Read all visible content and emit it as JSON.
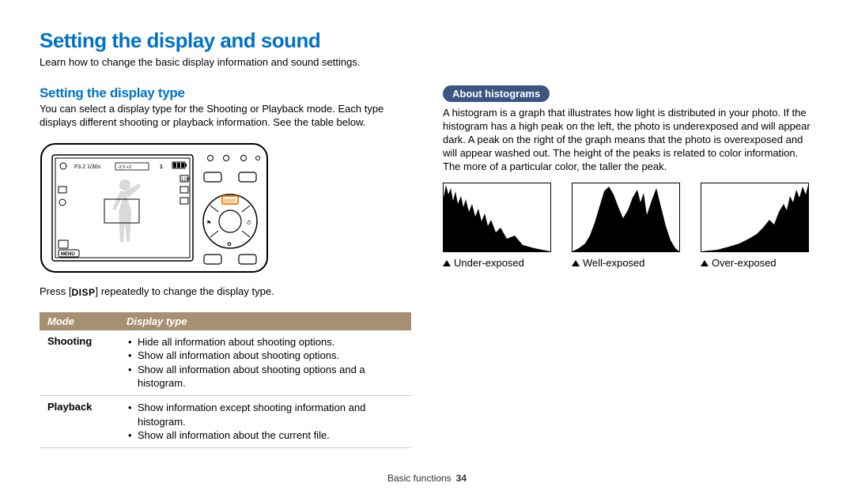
{
  "title": "Setting the display and sound",
  "intro": "Learn how to change the basic display information and sound settings.",
  "left": {
    "heading": "Setting the display type",
    "para": "You can select a display type for the Shooting or Playback mode. Each type displays different shooting or playback information. See the table below.",
    "press_prefix": "Press [",
    "press_badge": "DISP",
    "press_suffix": "] repeatedly to change the display type.",
    "table": {
      "head_mode": "Mode",
      "head_display": "Display type",
      "rows": [
        {
          "mode": "Shooting",
          "items": [
            "Hide all information about shooting options.",
            "Show all information about shooting options.",
            "Show all information about shooting options and a histogram."
          ]
        },
        {
          "mode": "Playback",
          "items": [
            "Show information except shooting information and histogram.",
            "Show all information about the current file."
          ]
        }
      ]
    },
    "camera": {
      "aperture": "F3.2 1/30s",
      "ev_bar": "-2   0   +2",
      "count": "1",
      "menu_label": "MENU",
      "disp_label": "DISP"
    }
  },
  "right": {
    "pill": "About histograms",
    "para": "A histogram is a graph that illustrates how light is distributed in your photo. If the histogram has a high peak on the left, the photo is underexposed and will appear dark. A peak on the right of the graph means that the photo is overexposed and will appear washed out. The height of the peaks is related to color information. The more of a particular color, the taller the peak.",
    "labels": {
      "under": "Under-exposed",
      "well": "Well-exposed",
      "over": "Over-exposed"
    }
  },
  "footer": {
    "section": "Basic functions",
    "page": "34"
  }
}
